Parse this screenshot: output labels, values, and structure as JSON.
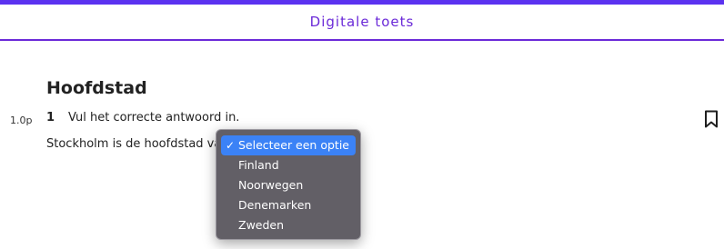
{
  "header": {
    "title": "Digitale toets",
    "accent_color": "#6b2ad8",
    "bar_color": "#5b32f0"
  },
  "section": {
    "title": "Hoofdstad"
  },
  "question": {
    "points": "1.0p",
    "number": "1",
    "instruction": "Vul het correcte antwoord in.",
    "sentence_prefix": "Stockholm is de hoofdstad van",
    "bookmark_icon": "bookmark-icon"
  },
  "dropdown": {
    "selected_index": 0,
    "options": [
      "Selecteer een optie",
      "Finland",
      "Noorwegen",
      "Denemarken",
      "Zweden"
    ],
    "highlight_color": "#3b82f6",
    "check_glyph": "✓"
  }
}
